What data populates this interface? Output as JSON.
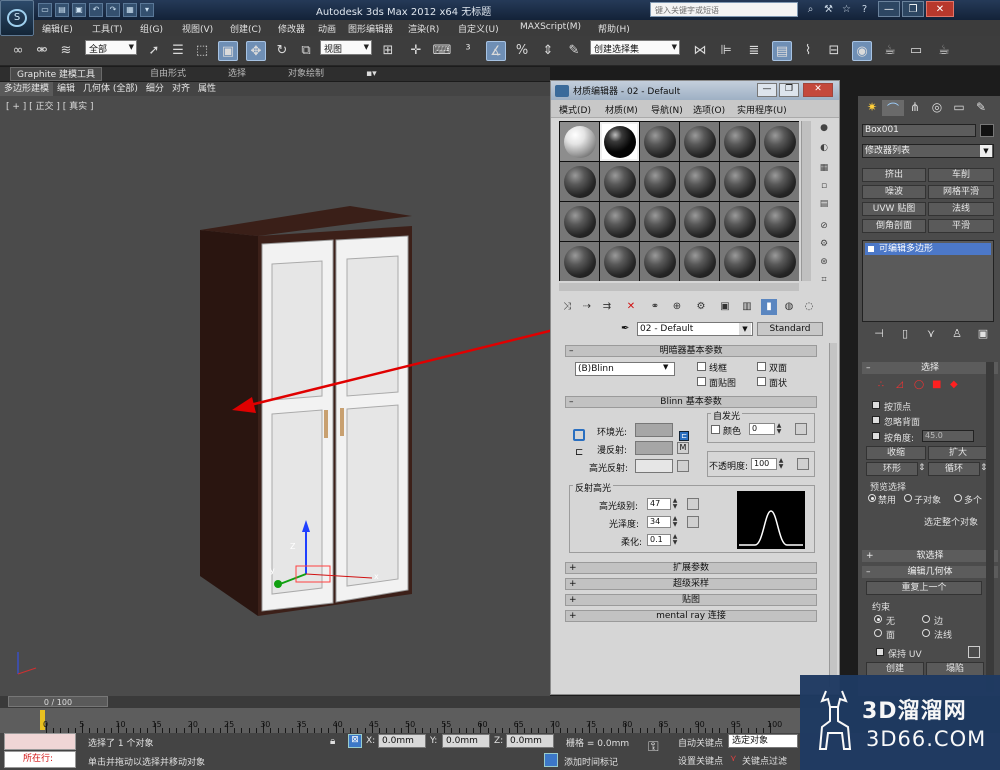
{
  "titlebar": {
    "title": "Autodesk 3ds Max  2012 x64      无标题",
    "search_placeholder": "键入关键字或短语"
  },
  "menubar": {
    "items": [
      "编辑(E)",
      "工具(T)",
      "组(G)",
      "视图(V)",
      "创建(C)",
      "修改器",
      "动画",
      "图形编辑器",
      "渲染(R)",
      "自定义(U)",
      "MAXScript(M)",
      "帮助(H)"
    ]
  },
  "toolbar": {
    "selection_filter": "全部",
    "ref_coord": "视图",
    "named_selection": "创建选择集"
  },
  "ribbon": {
    "tabs": [
      "Graphite 建模工具",
      "自由形式",
      "选择",
      "对象绘制"
    ],
    "subtabs": [
      "多边形建模",
      "编辑",
      "几何体 (全部)",
      "细分",
      "对齐",
      "属性"
    ]
  },
  "viewport": {
    "label": "[ + ] [ 正交 ] [ 真实 ]"
  },
  "material_editor": {
    "title": "材质编辑器 - 02 - Default",
    "menu": [
      "模式(D)",
      "材质(M)",
      "导航(N)",
      "选项(O)",
      "实用程序(U)"
    ],
    "material_name": "02 - Default",
    "material_type": "Standard",
    "shader_rollout": "明暗器基本参数",
    "shader_type": "(B)Blinn",
    "shader_checkboxes": [
      "线框",
      "双面",
      "面贴图",
      "面状"
    ],
    "blinn_rollout": "Blinn 基本参数",
    "self_illum_label": "自发光",
    "color_label": "颜色",
    "self_illum_value": "0",
    "ambient_label": "环境光:",
    "diffuse_label": "漫反射:",
    "specular_label": "高光反射:",
    "opacity_label": "不透明度:",
    "opacity_value": "100",
    "spec_group_label": "反射高光",
    "spec_level_label": "高光级别:",
    "spec_level_value": "47",
    "glossiness_label": "光泽度:",
    "glossiness_value": "34",
    "soften_label": "柔化:",
    "soften_value": "0.1",
    "m_label": "M",
    "rollouts": [
      "扩展参数",
      "超级采样",
      "贴图",
      "mental ray 连接"
    ],
    "colors": {
      "ambient": "#a6a6a6",
      "diffuse": "#a6a6a6",
      "specular": "#e6e6e6"
    }
  },
  "command_panel": {
    "object_name": "Box001",
    "modifier_list": "修改器列表",
    "modifier_buttons": [
      "挤出",
      "车削",
      "噪波",
      "网格平滑",
      "UVW 贴图",
      "法线",
      "倒角剖面",
      "平滑"
    ],
    "stack_item": "可编辑多边形",
    "selection_rollout": "选择",
    "sel_checkbox1": "按顶点",
    "sel_checkbox2": "忽略背面",
    "sel_checkbox3": "按角度:",
    "angle_value": "45.0",
    "shrink": "收缩",
    "grow": "扩大",
    "ring": "环形",
    "loop": "循环",
    "preview_group": "预览选择",
    "preview_opts": [
      "禁用",
      "子对象",
      "多个"
    ],
    "selected_whole": "选定整个对象",
    "soft_sel_rollout": "软选择",
    "edit_geom_rollout": "编辑几何体",
    "repeat_last": "重复上一个",
    "constraints_label": "约束",
    "constraint_opts": [
      "无",
      "边",
      "面",
      "法线"
    ],
    "keep_uv": "保持 UV",
    "create": "创建",
    "collapse": "塌陷"
  },
  "timeline": {
    "slider": "0 / 100",
    "ticks": [
      "0",
      "5",
      "10",
      "15",
      "20",
      "25",
      "30",
      "35",
      "40",
      "45",
      "50",
      "55",
      "60",
      "65",
      "70",
      "75",
      "80",
      "85",
      "90",
      "95",
      "100"
    ]
  },
  "status": {
    "mode": "所在行:",
    "message1": "选择了 1 个对象",
    "message2": "单击并拖动以选择并移动对象",
    "x_label": "X:",
    "x": "0.0mm",
    "y_label": "Y:",
    "y": "0.0mm",
    "z_label": "Z:",
    "z": "0.0mm",
    "grid": "栅格 = 0.0mm",
    "add_time_tag": "添加时间标记",
    "auto_key": "自动关键点",
    "set_key": "设置关键点",
    "key_filter": "选定对象",
    "key_filters": "关键点过滤"
  },
  "watermark": {
    "title": "3D溜溜网",
    "url": "3D66.COM"
  }
}
